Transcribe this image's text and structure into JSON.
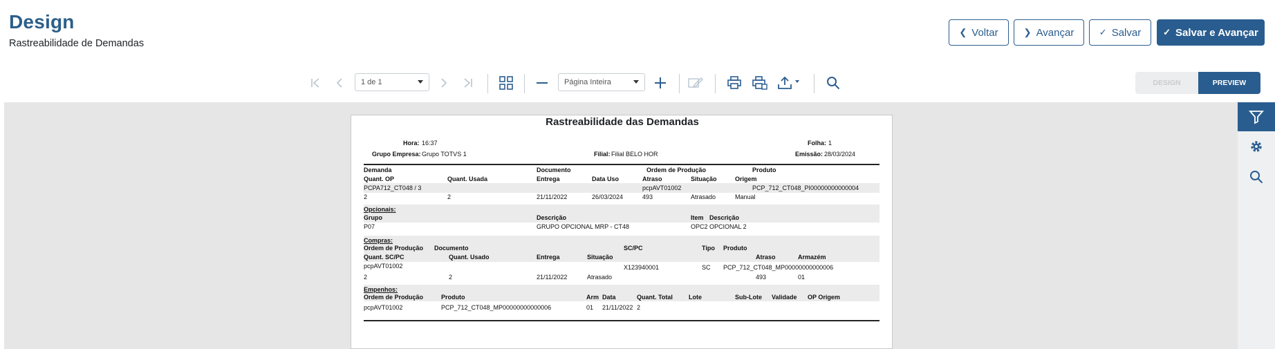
{
  "header": {
    "title": "Design",
    "subtitle": "Rastreabilidade de Demandas",
    "buttons": {
      "back": "Voltar",
      "next": "Avançar",
      "save": "Salvar",
      "save_next": "Salvar e Avançar"
    }
  },
  "toolbar": {
    "page_select": "1 de 1",
    "zoom_select": "Página Inteira",
    "mode_design": "DESIGN",
    "mode_preview": "PREVIEW",
    "colors": {
      "accent": "#2a5d8f",
      "disabled": "#b9c4cf"
    }
  },
  "report": {
    "title": "Rastreabilidade das Demandas",
    "meta": {
      "hora_label": "Hora:",
      "hora": "16:37",
      "folha_label": "Folha:",
      "folha": "1",
      "grupo_label": "Grupo Empresa:",
      "grupo": "Grupo TOTVS 1",
      "filial_label": "Filial:",
      "filial": "Filial BELO HOR",
      "emissao_label": "Emissão:",
      "emissao": "28/03/2024"
    },
    "demanda": {
      "headers": [
        "Demanda",
        "Documento",
        "Ordem de Produção",
        "Produto",
        "Quant. OP",
        "Quant. Usada",
        "Entrega",
        "Data Uso",
        "Atraso",
        "Situação",
        "Origem"
      ],
      "row1": {
        "demanda": "PCPA712_CT048  / 3",
        "ordem": "pcpAVT01002",
        "produto": "PCP_712_CT048_PI00000000000004"
      },
      "row2": {
        "quant_op": "2",
        "quant_usada": "2",
        "entrega": "21/11/2022",
        "data_uso": "26/03/2024",
        "atraso": "493",
        "situacao": "Atrasado",
        "origem": "Manual"
      }
    },
    "opcionais": {
      "section": "Opcionais:",
      "headers": [
        "Grupo",
        "Descrição",
        "Item",
        "Descrição"
      ],
      "row": {
        "grupo": "P07",
        "descricao": "GRUPO OPCIONAL MRP - CT48",
        "item": "OPC2",
        "descricao_item": "OPCIONAL 2"
      }
    },
    "compras": {
      "section": "Compras:",
      "headers": [
        "Ordem de Produção",
        "Documento",
        "SC/PC",
        "Tipo",
        "Produto",
        "Quant. SC/PC",
        "Quant. Usado",
        "Entrega",
        "Situação",
        "Atraso",
        "Armazém"
      ],
      "row1": {
        "ordem": "pcpAVT01002",
        "scpc": "X123940001",
        "tipo": "SC",
        "produto": "PCP_712_CT048_MP00000000000006"
      },
      "row2": {
        "quant_scpc": "2",
        "quant_usado": "2",
        "entrega": "21/11/2022",
        "situacao": "Atrasado",
        "atraso": "493",
        "armazem": "01"
      }
    },
    "empenhos": {
      "section": "Empenhos:",
      "headers": [
        "Ordem de Produção",
        "Produto",
        "Arm",
        "Data",
        "Quant. Total",
        "Lote",
        "Sub-Lote",
        "Validade",
        "OP Origem"
      ],
      "row": {
        "ordem": "pcpAVT01002",
        "produto": "PCP_712_CT048_MP00000000000006",
        "arm": "01",
        "data": "21/11/2022",
        "quant_total": "2"
      }
    }
  },
  "sidebar_icons": [
    "filter-icon",
    "gear-icon",
    "search-icon"
  ]
}
